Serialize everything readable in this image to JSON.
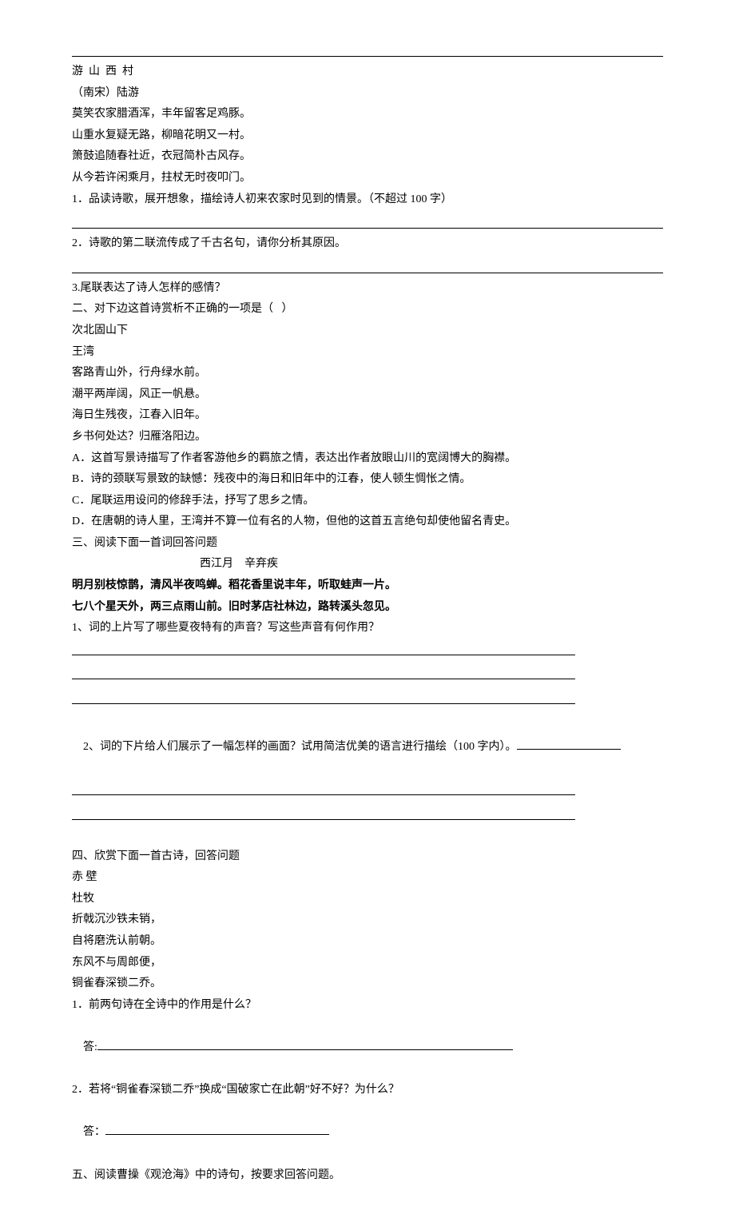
{
  "s1": {
    "title": "游  山  西  村",
    "author": "（南宋）陆游",
    "lines": [
      "莫笑农家腊酒浑，丰年留客足鸡豚。",
      "山重水复疑无路，柳暗花明又一村。",
      "箫鼓追随春社近，衣冠简朴古风存。",
      "从今若许闲乘月，拄杖无时夜叩门。"
    ],
    "q1": "1．品读诗歌，展开想象，描绘诗人初来农家时见到的情景。（不超过 100 字）",
    "q2": "2．诗歌的第二联流传成了千古名句，请你分析其原因。",
    "q3": "3.尾联表达了诗人怎样的感情？"
  },
  "s2": {
    "intro": "二、对下边这首诗赏析不正确的一项是（   ）",
    "title": "次北固山下",
    "author": "王湾",
    "lines": [
      "客路青山外，行舟绿水前。",
      "潮平两岸阔，风正一帆悬。",
      "海日生残夜，江春入旧年。",
      "乡书何处达？归雁洛阳边。"
    ],
    "opts": {
      "A": "A．这首写景诗描写了作者客游他乡的羁旅之情，表达出作者放眼山川的宽阔博大的胸襟。",
      "B": "B．诗的颈联写景致的缺憾：残夜中的海日和旧年中的江春，使人顿生惆怅之情。",
      "C": "C．尾联运用设问的修辞手法，抒写了思乡之情。",
      "D": "D．在唐朝的诗人里，王湾并不算一位有名的人物，但他的这首五言绝句却使他留名青史。"
    }
  },
  "s3": {
    "intro": "三、阅读下面一首词回答问题",
    "title": "西江月    辛弃疾",
    "l1": "明月别枝惊鹊，清风半夜鸣蝉。稻花香里说丰年，听取蛙声一片。",
    "l2": "七八个星天外，两三点雨山前。旧时茅店社林边，路转溪头忽见。",
    "q1": "1、词的上片写了哪些夏夜特有的声音？写这些声音有何作用？",
    "q2": "2、词的下片给人们展示了一幅怎样的画面？试用简洁优美的语言进行描绘（100 字内）。"
  },
  "s4": {
    "intro": "四、欣赏下面一首古诗，回答问题",
    "title": "赤 壁",
    "author": "杜牧",
    "lines": [
      "折戟沉沙铁未销，",
      "自将磨洗认前朝。",
      "东风不与周郎便，",
      "铜雀春深锁二乔。"
    ],
    "q1": "1．前两句诗在全诗中的作用是什么？",
    "a1label": "答:",
    "q2": "2．若将“铜雀春深锁二乔”换成“国破家亡在此朝”好不好？为什么？",
    "a2label": "答："
  },
  "s5": {
    "intro": "五、阅读曹操《观沧海》中的诗句，按要求回答问题。"
  }
}
